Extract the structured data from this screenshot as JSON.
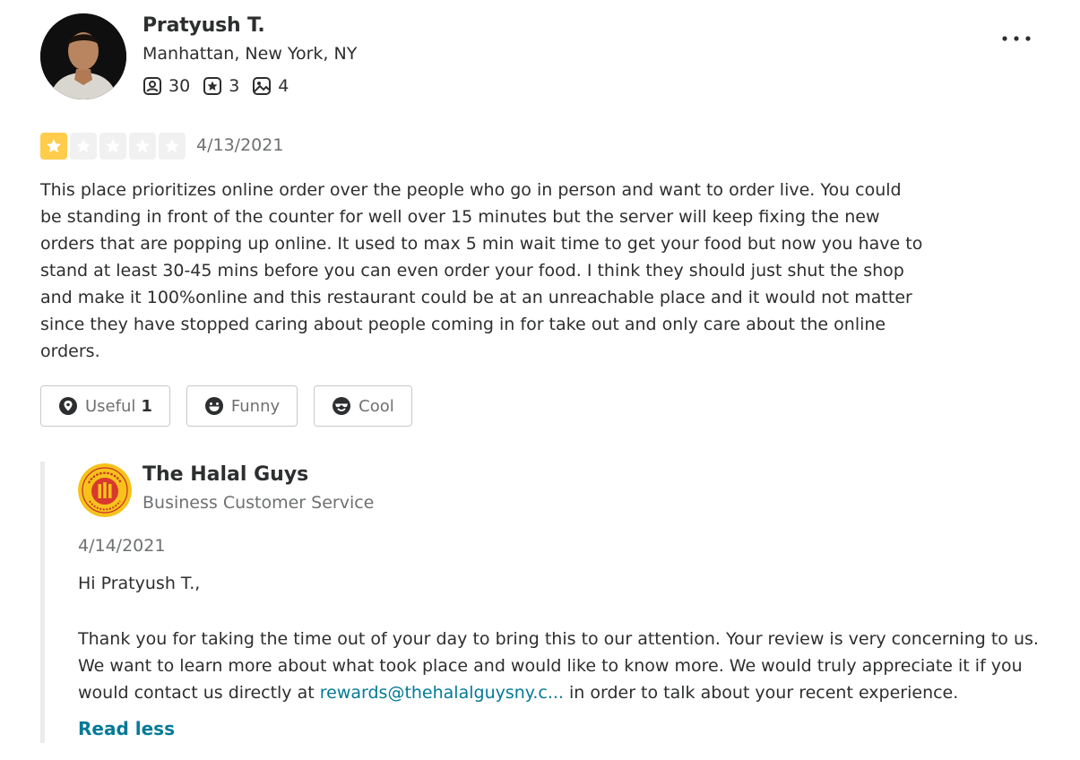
{
  "review": {
    "user": {
      "name": "Pratyush T.",
      "location": "Manhattan, New York, NY",
      "stats": {
        "friends": "30",
        "reviews": "3",
        "photos": "4"
      }
    },
    "rating": 1,
    "rating_max": 5,
    "date": "4/13/2021",
    "text": "This place prioritizes online order over the people who go in person and want to order live. You could be standing in front of the counter for well over 15 minutes but the server will keep fixing the new orders that are popping up online. It used to max 5 min wait time to get your food but now you have to stand at least 30-45 mins before you can even order your food. I think they should just shut the shop and make it 100%online and this restaurant could be at an unreachable place and it would not matter since they have stopped caring about people coming in for take out and only care about the online orders.",
    "reactions": {
      "useful_label": "Useful",
      "useful_count": "1",
      "funny_label": "Funny",
      "cool_label": "Cool"
    }
  },
  "reply": {
    "business_name": "The Halal Guys",
    "role": "Business Customer Service",
    "date": "4/14/2021",
    "greeting": "Hi Pratyush T.,",
    "body_before": "Thank you for taking the time out of your day to bring this to our attention. Your review is very concerning to us. We want to learn more about what took place and would like to know more. We would truly appreciate it if you would contact us directly at ",
    "email_link": "rewards@thehalalguysny.c...",
    "body_after": " in order to talk about your recent experience.",
    "read_less": "Read less"
  },
  "colors": {
    "star_on": "#ffcc4b",
    "star_off": "#f1f1f1",
    "link": "#027a97",
    "muted": "#6e7072"
  },
  "icons": [
    "friends-icon",
    "review-star-icon",
    "photo-icon",
    "more-options-icon",
    "useful-icon",
    "funny-icon",
    "cool-icon"
  ]
}
